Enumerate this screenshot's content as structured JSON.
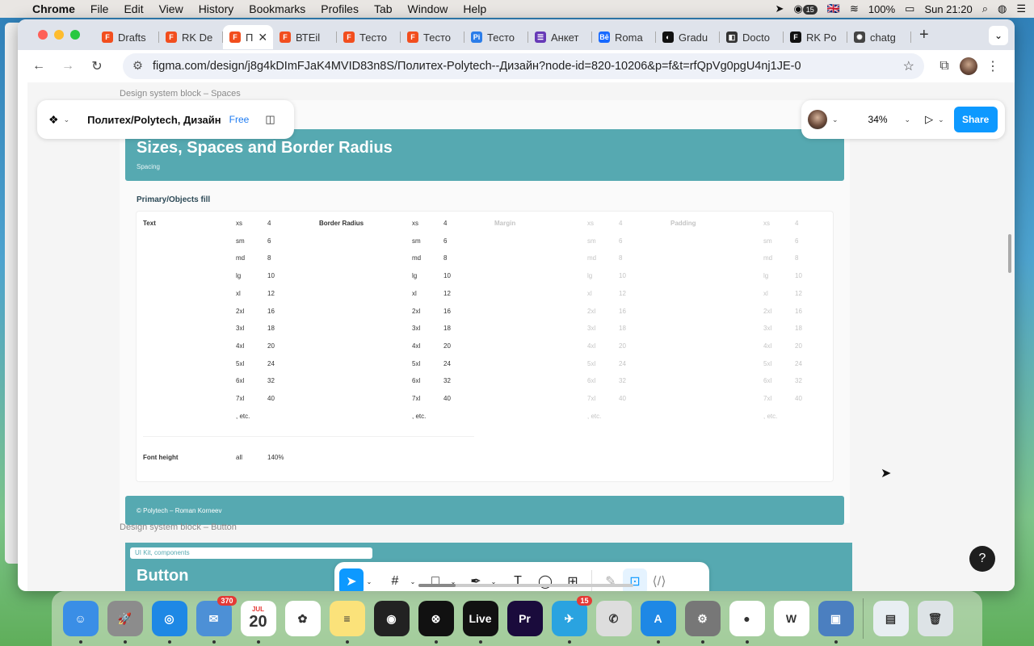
{
  "menubar": {
    "apple": "",
    "items": [
      "Chrome",
      "File",
      "Edit",
      "View",
      "History",
      "Bookmarks",
      "Profiles",
      "Tab",
      "Window",
      "Help"
    ],
    "battery": "100%",
    "flag": "🇬🇧",
    "clock": "Sun 21:20",
    "notif_count": "15"
  },
  "tabs": [
    {
      "label": "Drafts",
      "color": "#f24e1e",
      "glyph": "F"
    },
    {
      "label": "RK De",
      "color": "#f24e1e",
      "glyph": "F"
    },
    {
      "label": "П",
      "color": "#f24e1e",
      "glyph": "F",
      "active": true
    },
    {
      "label": "ВТЕil",
      "color": "#f24e1e",
      "glyph": "F"
    },
    {
      "label": "Тесто",
      "color": "#f24e1e",
      "glyph": "F"
    },
    {
      "label": "Тесто",
      "color": "#f24e1e",
      "glyph": "F"
    },
    {
      "label": "Тесто",
      "color": "#2b7de9",
      "glyph": "Pi"
    },
    {
      "label": "Анкет",
      "color": "#673ab7",
      "glyph": "☰"
    },
    {
      "label": "Roma",
      "color": "#1769ff",
      "glyph": "Bē"
    },
    {
      "label": "Gradu",
      "color": "#111111",
      "glyph": "◐"
    },
    {
      "label": "Docto",
      "color": "#333333",
      "glyph": "◧"
    },
    {
      "label": "RK Po",
      "color": "#111111",
      "glyph": "F"
    },
    {
      "label": "chatg",
      "color": "#444444",
      "glyph": "✺"
    }
  ],
  "address": {
    "url": "figma.com/design/j8g4kDImFJaK4MVID83n8S/Политех-Polytech--Дизайн?node-id=820-10206&p=f&t=rfQpVg0pgU4nj1JE-0"
  },
  "figma": {
    "file_name": "Политех/Polytech, Дизайн",
    "plan": "Free",
    "zoom": "34%",
    "share_label": "Share",
    "help_label": "?"
  },
  "canvas": {
    "label_spaces": "Design system block – Spaces",
    "label_button": "Design system block – Button",
    "banner_title": "Sizes, Spaces and Border Radius",
    "banner_sub": "Spacing",
    "section_title": "Primary/Objects fill",
    "footer": "© Polytech – Roman Korneev",
    "button_chip": "UI Kit, components",
    "button_title": "Button"
  },
  "spec_table": {
    "groups": [
      {
        "title": "Text",
        "dim": false
      },
      {
        "title": "Border Radius",
        "dim": false
      },
      {
        "title": "Margin",
        "dim": true
      },
      {
        "title": "Padding",
        "dim": true
      }
    ],
    "sizes": [
      "xs",
      "sm",
      "md",
      "lg",
      "xl",
      "2xl",
      "3xl",
      "4xl",
      "5xl",
      "6xl",
      "7xl",
      ", etc."
    ],
    "values": [
      "4",
      "6",
      "8",
      "10",
      "12",
      "16",
      "18",
      "20",
      "24",
      "32",
      "40",
      ""
    ],
    "font_height_label": "Font height",
    "font_height_size": "all",
    "font_height_value": "140%"
  },
  "dock": [
    {
      "name": "finder",
      "color": "#3a8ee6",
      "glyph": "☺"
    },
    {
      "name": "launchpad",
      "color": "#8c8c8c",
      "glyph": "🚀"
    },
    {
      "name": "safari",
      "color": "#1e88e5",
      "glyph": "◎"
    },
    {
      "name": "mail",
      "color": "#4d90d6",
      "glyph": "✉",
      "badge": "370"
    },
    {
      "name": "calendar",
      "color": "#ffffff",
      "glyph": "20",
      "month": "JUL"
    },
    {
      "name": "photos",
      "color": "#ffffff",
      "glyph": "✿"
    },
    {
      "name": "notes",
      "color": "#fbe27a",
      "glyph": "≡"
    },
    {
      "name": "obs",
      "color": "#222222",
      "glyph": "◉"
    },
    {
      "name": "capcut",
      "color": "#111111",
      "glyph": "⊗"
    },
    {
      "name": "live",
      "color": "#111111",
      "glyph": "Live"
    },
    {
      "name": "premiere",
      "color": "#1a0b3c",
      "glyph": "Pr"
    },
    {
      "name": "telegram",
      "color": "#2aa3e0",
      "glyph": "✈",
      "badge": "15"
    },
    {
      "name": "whatsapp",
      "color": "#dddddd",
      "glyph": "✆"
    },
    {
      "name": "app-store",
      "color": "#1e88e5",
      "glyph": "A"
    },
    {
      "name": "system-settings",
      "color": "#777777",
      "glyph": "⚙"
    },
    {
      "name": "chrome",
      "color": "#ffffff",
      "glyph": "●"
    },
    {
      "name": "word",
      "color": "#ffffff",
      "glyph": "W"
    },
    {
      "name": "preview",
      "color": "#4b7fc0",
      "glyph": "▣"
    },
    {
      "name": "downloads-stack",
      "color": "#e8eef2",
      "glyph": "▤"
    },
    {
      "name": "trash",
      "color": "#dde3e6",
      "glyph": "🗑"
    }
  ]
}
